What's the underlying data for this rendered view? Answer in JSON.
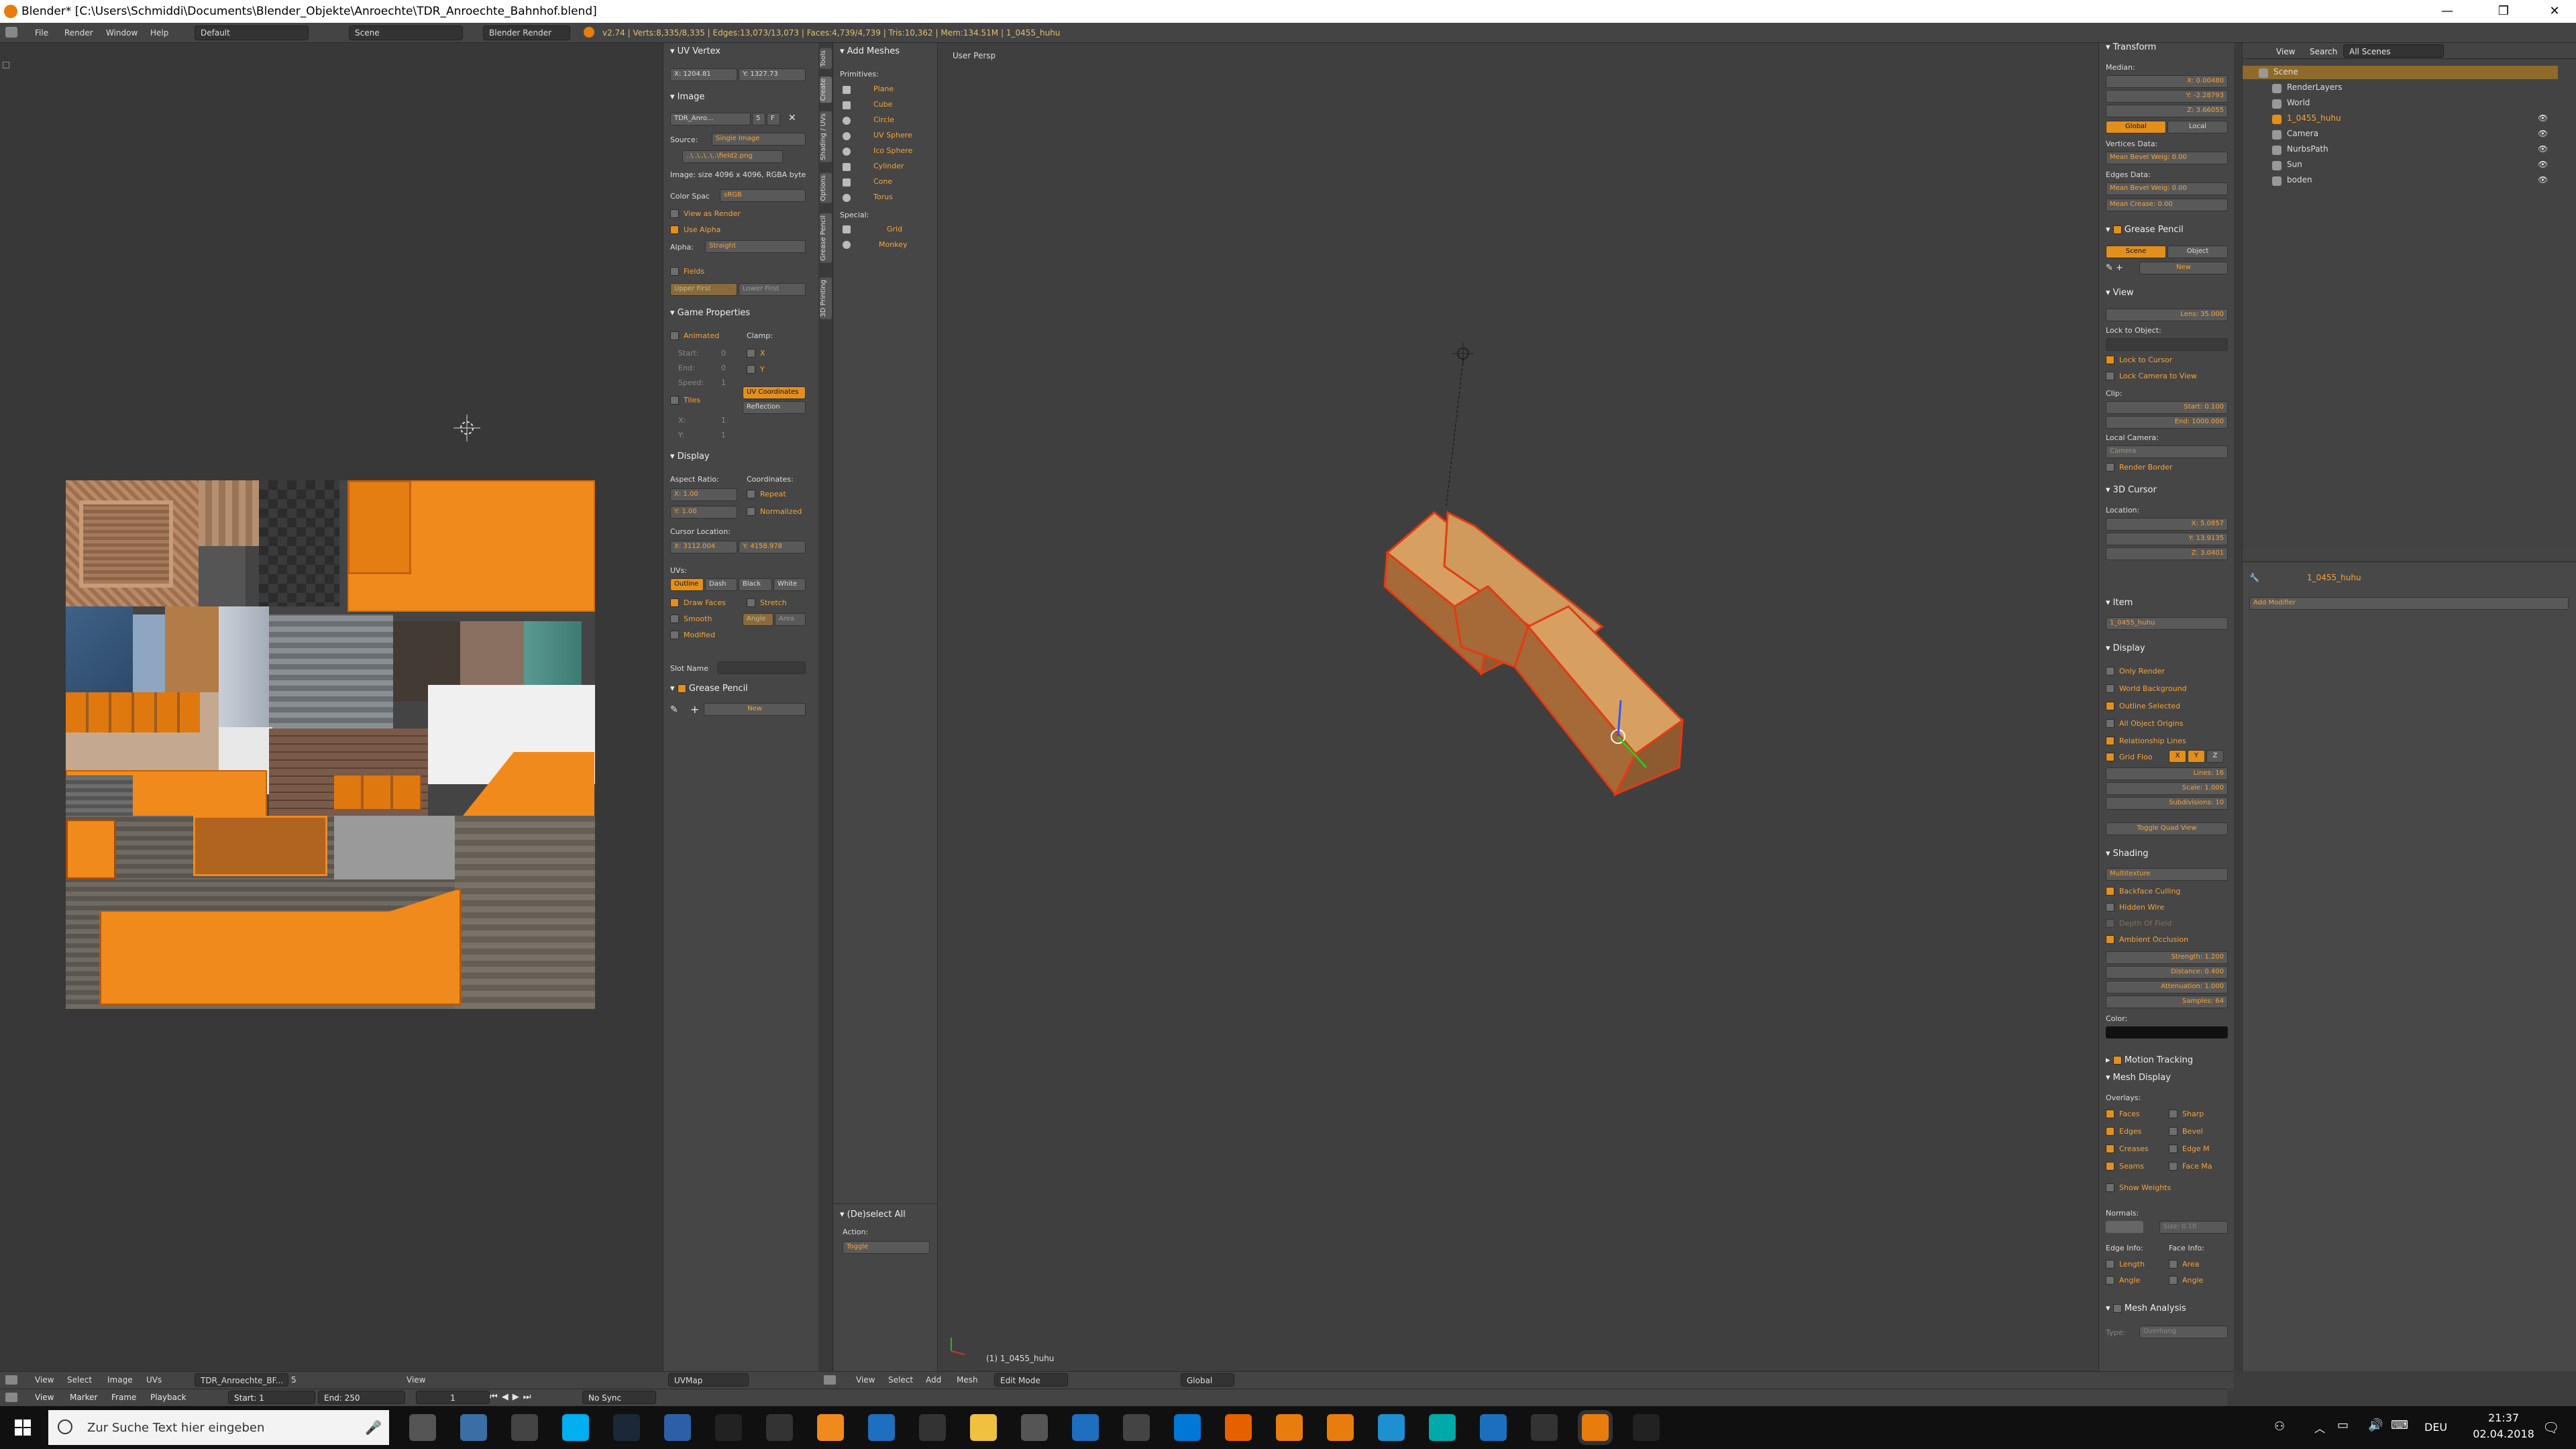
{
  "window": {
    "title": "Blender* [C:\\Users\\Schmiddi\\Documents\\Blender_Objekte\\Anroechte\\TDR_Anroechte_Bahnhof.blend]",
    "minimize": "—",
    "maximize": "❐",
    "close": "✕"
  },
  "infobar": {
    "menus": [
      "File",
      "Render",
      "Window",
      "Help"
    ],
    "layout": "Default",
    "scene": "Scene",
    "engine": "Blender Render",
    "stats": "v2.74 | Verts:8,335/8,335 | Edges:13,073/13,073 | Faces:4,739/4,739 | Tris:10,362 | Mem:134.51M | 1_0455_huhu"
  },
  "uv_npanel": {
    "uv_vertex": {
      "header": "UV Vertex",
      "x": "X: 1204.81",
      "y": "Y: 1327.73"
    },
    "image": {
      "header": "Image",
      "name": "TDR_Anro...",
      "users": "5",
      "fake": "F",
      "source_label": "Source:",
      "source": "Single Image",
      "path": "..\\..\\..\\..\\..\\field2.png",
      "info": "Image: size 4096 x 4096, RGBA byte",
      "colorspace_label": "Color Spac",
      "colorspace": "sRGB",
      "view_as_render": "View as Render",
      "use_alpha": "Use Alpha",
      "alpha_label": "Alpha:",
      "alpha": "Straight",
      "fields": "Fields",
      "upper_first": "Upper First",
      "lower_first": "Lower First"
    },
    "game": {
      "header": "Game Properties",
      "animated": "Animated",
      "clamp": "Clamp:",
      "start": "Start:",
      "start_v": "0",
      "end": "End:",
      "end_v": "0",
      "speed": "Speed:",
      "speed_v": "1",
      "clamp_x": "X",
      "clamp_y": "Y",
      "tiles": "Tiles",
      "tx": "X:",
      "tx_v": "1",
      "ty": "Y:",
      "ty_v": "1",
      "uv_coordinates": "UV Coordinates",
      "reflection": "Reflection"
    },
    "display": {
      "header": "Display",
      "aspect": "Aspect Ratio:",
      "coords": "Coordinates:",
      "ax": "X: 1.00",
      "ay": "Y: 1.00",
      "repeat": "Repeat",
      "normalized": "Normalized",
      "cursor_loc": "Cursor Location:",
      "cx": "X: 3112.004",
      "cy": "Y: 4158.978",
      "uvs": "UVs:",
      "outline": "Outline",
      "dash": "Dash",
      "black": "Black",
      "white": "White",
      "draw_faces": "Draw Faces",
      "stretch": "Stretch",
      "smooth": "Smooth",
      "angle": "Angle",
      "area": "Area",
      "modified": "Modified",
      "slot_name": "Slot Name"
    },
    "grease": {
      "header": "Grease Pencil",
      "new": "New"
    }
  },
  "vtabs": [
    "Tools",
    "Create",
    "Shading / UVs",
    "Options",
    "Grease Pencil",
    "3D Printing"
  ],
  "toolshelf": {
    "header": "Add Meshes",
    "primitives": "Primitives:",
    "items": [
      "Plane",
      "Cube",
      "Circle",
      "UV Sphere",
      "Ico Sphere",
      "Cylinder",
      "Cone",
      "Torus"
    ],
    "special": "Special:",
    "special_items": [
      "Grid",
      "Monkey"
    ],
    "op_header": "(De)select All",
    "action_label": "Action:",
    "action": "Toggle"
  },
  "viewport": {
    "label": "User Persp",
    "object": "(1) 1_0455_huhu"
  },
  "props": {
    "transform": "Transform",
    "median": "Median:",
    "mx": "X: 0.00480",
    "my": "Y: -2.28793",
    "mz": "Z: 3.66055",
    "global": "Global",
    "local": "Local",
    "verts_data": "Vertices Data:",
    "mean_bevel_v": "Mean Bevel Weig: 0.00",
    "edges_data": "Edges Data:",
    "mean_bevel_e": "Mean Bevel Weig: 0.00",
    "mean_crease": "Mean Crease: 0.00",
    "grease": "Grease Pencil",
    "scene": "Scene",
    "object": "Object",
    "new": "New",
    "view": "View",
    "lens": "Lens: 35.000",
    "lock_obj": "Lock to Object:",
    "lock_cursor": "Lock to Cursor",
    "lock_cam": "Lock Camera to View",
    "clip": "Clip:",
    "clip_start": "Start: 0.100",
    "clip_end": "End: 1000.000",
    "local_camera": "Local Camera:",
    "camera": "Camera",
    "render_border": "Render Border",
    "cursor": "3D Cursor",
    "location": "Location:",
    "cx": "X: 5.0857",
    "cy": "Y: 13.9135",
    "cz": "Z: 3.0401",
    "item": "Item",
    "item_name": "1_0455_huhu",
    "display": "Display",
    "only_render": "Only Render",
    "world_bg": "World Background",
    "outline_sel": "Outline Selected",
    "all_origins": "All Object Origins",
    "rel_lines": "Relationship Lines",
    "grid_floor": "Grid Floo",
    "gx": "X",
    "gy": "Y",
    "gz": "Z",
    "lines": "Lines: 16",
    "scale": "Scale: 1.000",
    "subdiv": "Subdivisions: 10",
    "quad": "Toggle Quad View",
    "shading": "Shading",
    "multitexture": "Multitexture",
    "backface": "Backface Culling",
    "hidden_wire": "Hidden Wire",
    "dof": "Depth Of Field",
    "ao": "Ambient Occlusion",
    "strength": "Strength: 1.200",
    "distance": "Distance: 0.400",
    "attenuation": "Attenuation: 1.000",
    "samples": "Samples: 64",
    "color": "Color:",
    "motion": "Motion Tracking",
    "mesh_display": "Mesh Display",
    "overlays": "Overlays:",
    "faces": "Faces",
    "sharp": "Sharp",
    "edges": "Edges",
    "bevel": "Bevel",
    "creases": "Creases",
    "edge_m": "Edge M",
    "seams": "Seams",
    "face_ma": "Face Ma",
    "show_weights": "Show Weights",
    "normals": "Normals:",
    "size": "Size: 0.10",
    "edge_info": "Edge Info:",
    "face_info": "Face Info:",
    "length": "Length",
    "area": "Area",
    "angle": "Angle",
    "angle2": "Angle",
    "mesh_analysis": "Mesh Analysis",
    "type": "Type:",
    "overhang": "Overhang"
  },
  "outliner": {
    "menus": [
      "View",
      "Search",
      "All Scenes"
    ],
    "items": [
      "Scene",
      "RenderLayers",
      "World",
      "1_0455_huhu",
      "Camera",
      "NurbsPath",
      "Sun",
      "boden"
    ]
  },
  "propeditor": {
    "object": "1_0455_huhu",
    "add_modifier": "Add Modifier"
  },
  "uv_footer": [
    "View",
    "Select",
    "Image",
    "UVs"
  ],
  "uv_footer_img": "TDR_Anroechte_BF...",
  "uv_footer_users": "5",
  "uv_footer_view": "View",
  "uv_footer_map": "UVMap",
  "vp_footer": [
    "View",
    "Select",
    "Add",
    "Mesh"
  ],
  "vp_mode": "Edit Mode",
  "vp_orient": "Global",
  "timeline": {
    "menus": [
      "View",
      "Marker",
      "Frame",
      "Playback"
    ],
    "start": "Start: 1",
    "end": "End: 250",
    "current": "1",
    "sync": "No Sync"
  },
  "taskbar": {
    "search": "Zur Suche Text hier eingeben",
    "lang": "DEU",
    "time": "21:37",
    "date": "02.04.2018"
  },
  "colors": {
    "accent": "#e38f1c",
    "uv_orange": "#f08a1c",
    "mesh_top": "#d8a060",
    "mesh_edge": "#e43a12"
  }
}
